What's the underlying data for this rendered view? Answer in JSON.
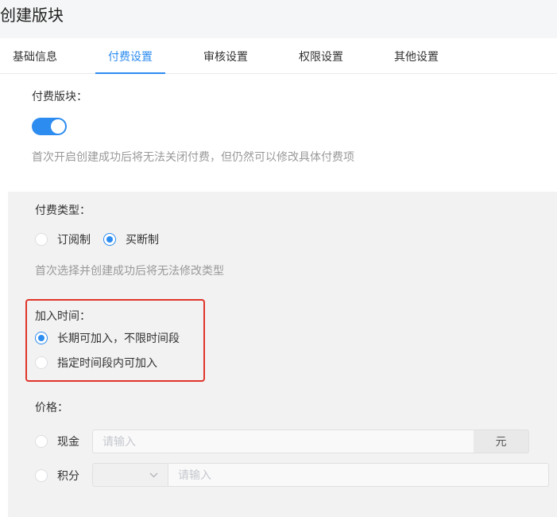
{
  "page": {
    "title": "创建版块"
  },
  "tabs": [
    {
      "label": "基础信息",
      "active": false
    },
    {
      "label": "付费设置",
      "active": true
    },
    {
      "label": "审核设置",
      "active": false
    },
    {
      "label": "权限设置",
      "active": false
    },
    {
      "label": "其他设置",
      "active": false
    }
  ],
  "paid_block": {
    "label": "付费版块：",
    "enabled": true,
    "hint": "首次开启创建成功后将无法关闭付费，但仍然可以修改具体付费项"
  },
  "pay_type": {
    "label": "付费类型：",
    "options": [
      {
        "label": "订阅制",
        "checked": false
      },
      {
        "label": "买断制",
        "checked": true
      }
    ],
    "hint": "首次选择并创建成功后将无法修改类型"
  },
  "join_time": {
    "label": "加入时间：",
    "options": [
      {
        "label": "长期可加入，不限时间段",
        "checked": true
      },
      {
        "label": "指定时间段内可加入",
        "checked": false
      }
    ]
  },
  "price": {
    "label": "价格：",
    "cash": {
      "label": "现金",
      "checked": false,
      "placeholder": "请输入",
      "unit": "元"
    },
    "points": {
      "label": "积分",
      "checked": false,
      "placeholder": "请输入"
    }
  },
  "colors": {
    "accent": "#2d8cf0",
    "highlight": "#e0352b"
  },
  "icons": {
    "select_arrow": "chevron-down-icon"
  }
}
